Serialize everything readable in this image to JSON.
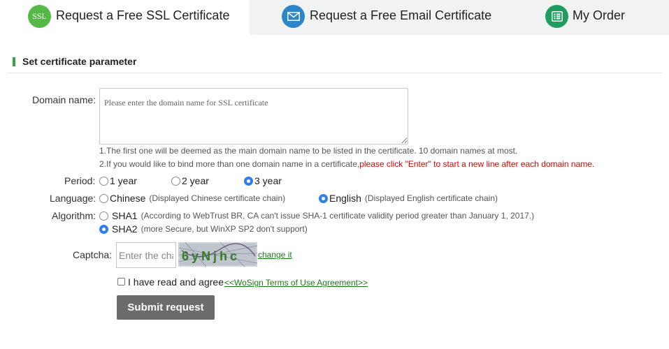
{
  "tabs": [
    {
      "label": "Request a Free SSL Certificate",
      "icon": "ssl-icon",
      "icon_text": "SSL",
      "icon_color": "#56b947",
      "active": true
    },
    {
      "label": "Request a Free Email Certificate",
      "icon": "envelope-icon",
      "icon_color": "#2e86c9",
      "active": false
    },
    {
      "label": "My Order",
      "icon": "order-list-icon",
      "icon_color": "#1e9e5e",
      "active": false
    }
  ],
  "section": {
    "title": "Set certificate parameter"
  },
  "domain": {
    "label": "Domain name:",
    "placeholder": "Please enter the domain name for SSL certificate",
    "hint1": "1.The first one will be deemed as the main domain name to be listed in the certificate. 10 domain names at most.",
    "hint2_prefix": "2.If you would like to bind more than one domain name in a certificate,",
    "hint2_red": "please click \"Enter\" to start a new line after each domain name."
  },
  "period": {
    "label": "Period:",
    "options": [
      "1 year",
      "2 year",
      "3 year"
    ],
    "selected": "3 year"
  },
  "language": {
    "label": "Language:",
    "options": [
      {
        "label": "Chinese",
        "note": "(Displayed Chinese certificate chain)"
      },
      {
        "label": "English",
        "note": "(Displayed English certificate chain)"
      }
    ],
    "selected": "English"
  },
  "algorithm": {
    "label": "Algorithm:",
    "options": [
      {
        "label": "SHA1",
        "note": "(According to WebTrust BR, CA can't issue SHA-1 certificate validity period greater than January 1, 2017.)"
      },
      {
        "label": "SHA2",
        "note": "(more Secure, but WinXP SP2 don't support)"
      }
    ],
    "selected": "SHA2"
  },
  "captcha": {
    "label": "Captcha:",
    "placeholder": "Enter the cha",
    "image_text": "6yNjhc",
    "change_link": "change it"
  },
  "agreement": {
    "text": "I have read and agree",
    "link": "<<WoSign Terms of Use Agreement>>",
    "checked": false
  },
  "submit": {
    "label": "Submit request"
  },
  "colors": {
    "accent_green": "#3aa04a",
    "link_green": "#1c7a16",
    "radio_blue": "#2f7ff0",
    "warning_red": "#e00000",
    "submit_gray": "#6b6b6b"
  }
}
